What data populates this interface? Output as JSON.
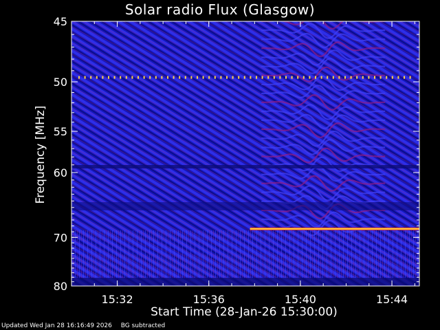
{
  "chart_data": {
    "type": "heatmap",
    "title": "Solar radio Flux (Glasgow)",
    "xlabel": "Start Time (28-Jan-26 15:30:00)",
    "ylabel": "Frequency [MHz]",
    "x_unit": "minutes after 15:30:00",
    "xlim": [
      0,
      15.2
    ],
    "ylim": [
      45,
      80
    ],
    "y_scale": "reciprocal",
    "x_ticks": [
      {
        "minute": 2,
        "label": "15:32"
      },
      {
        "minute": 6,
        "label": "15:36"
      },
      {
        "minute": 10,
        "label": "15:40"
      },
      {
        "minute": 14,
        "label": "15:44"
      }
    ],
    "y_ticks": [
      {
        "value": 45,
        "label": "45"
      },
      {
        "value": 50,
        "label": "50"
      },
      {
        "value": 55,
        "label": "55"
      },
      {
        "value": 60,
        "label": "60"
      },
      {
        "value": 70,
        "label": "70"
      },
      {
        "value": 80,
        "label": "80"
      }
    ],
    "colormap": [
      "#0a0a6e",
      "#1c1ccc",
      "#3f3ff5",
      "#8b1c8b",
      "#e03a20",
      "#ffd24a"
    ],
    "features": [
      {
        "name": "interference-band",
        "freq_mhz": 49.6,
        "start_min": 0.3,
        "end_min": 15.0,
        "pattern": "dotted"
      },
      {
        "name": "interference-band",
        "freq_mhz": 68.5,
        "start_min": 7.8,
        "end_min": 15.2,
        "pattern": "solid"
      },
      {
        "name": "wave-pattern",
        "freq_range_mhz": [
          45,
          70
        ],
        "center_min": 11.0
      }
    ]
  },
  "footer": {
    "updated": "Updated Wed Jan 28 16:16:49 2026",
    "note": "BG subtracted"
  }
}
